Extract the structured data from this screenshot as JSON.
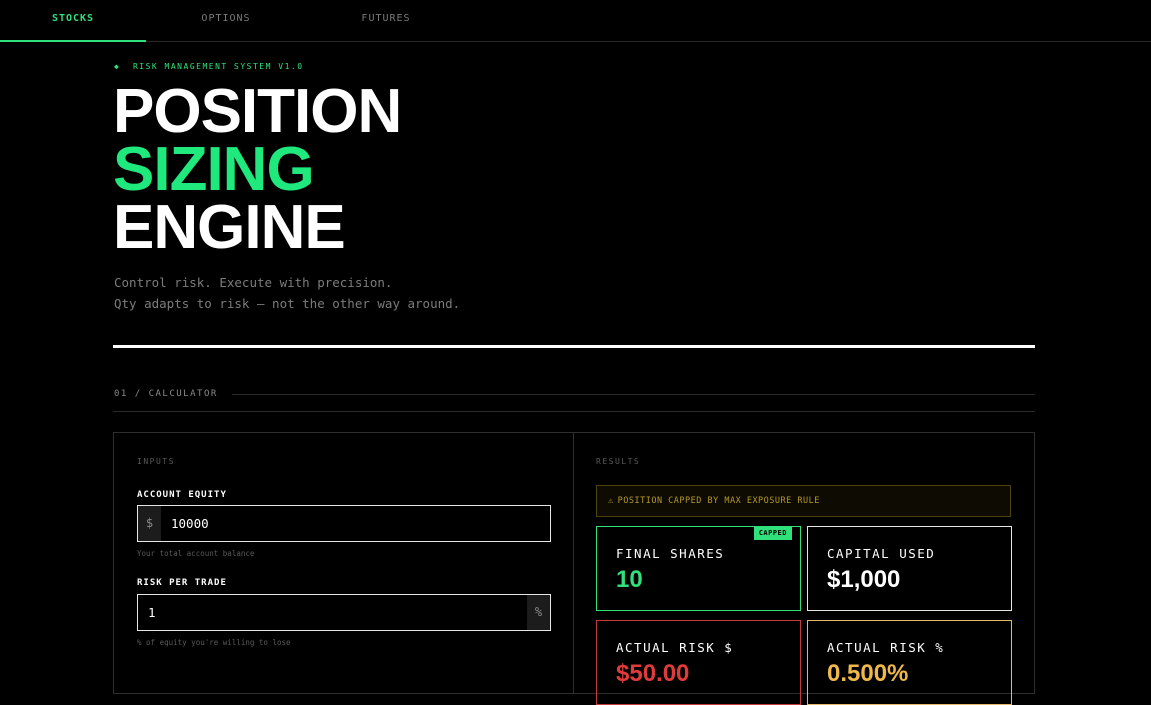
{
  "tabs": [
    {
      "label": "STOCKS",
      "active": true
    },
    {
      "label": "OPTIONS",
      "active": false
    },
    {
      "label": "FUTURES",
      "active": false
    }
  ],
  "hero": {
    "kicker_icon": "diamond-icon",
    "kicker": "RISK MANAGEMENT SYSTEM V1.0",
    "title_line1": "POSITION",
    "title_line2": "SIZING",
    "title_line3": "ENGINE",
    "subtitle_line1": "Control risk. Execute with precision.",
    "subtitle_line2": "Qty adapts to risk — not the other way around."
  },
  "section": {
    "label": "01 / CALCULATOR"
  },
  "inputs": {
    "panel_label": "INPUTS",
    "account_equity": {
      "label": "ACCOUNT EQUITY",
      "prefix": "$",
      "value": "10000",
      "hint": "Your total account balance"
    },
    "risk_per_trade": {
      "label": "RISK PER TRADE",
      "suffix": "%",
      "value": "1",
      "hint": "% of equity you're willing to lose"
    }
  },
  "results": {
    "panel_label": "RESULTS",
    "warning_icon": "warning-triangle-icon",
    "warning": "POSITION CAPPED BY MAX EXPOSURE RULE",
    "final_shares": {
      "label": "FINAL SHARES",
      "value": "10",
      "badge": "CAPPED"
    },
    "capital_used": {
      "label": "CAPITAL USED",
      "value": "$1,000"
    },
    "actual_risk_usd": {
      "label": "ACTUAL RISK $",
      "value": "$50.00"
    },
    "actual_risk_pct": {
      "label": "ACTUAL RISK %",
      "value": "0.500%"
    }
  },
  "colors": {
    "accent": "#2fe07b",
    "warning": "#b59a2a",
    "danger": "#e03b3b",
    "amber": "#f0b84a"
  }
}
